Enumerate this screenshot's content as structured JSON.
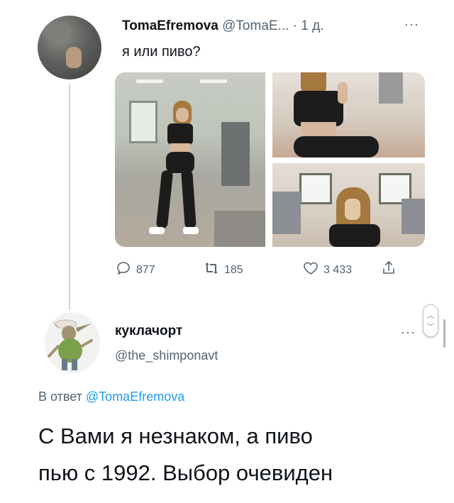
{
  "tweet": {
    "author_name": "TomaEfremova",
    "author_handle": "@TomaE...",
    "time": "· 1 д.",
    "more": "···",
    "text": "я или пиво?",
    "stats": {
      "replies": "877",
      "retweets": "185",
      "likes": "3 433"
    }
  },
  "reply": {
    "author_name": "куклачорт",
    "author_handle": "@the_shimponavt",
    "more": "···",
    "reply_prefix": "В ответ",
    "reply_to": "@TomaEfremova",
    "text_line1": "С Вами я незнаком, а пиво",
    "text_line2": "пью с 1992. Выбор очевиден"
  },
  "icons": {
    "reply": "reply-icon",
    "retweet": "retweet-icon",
    "like": "heart-icon",
    "share": "share-icon"
  },
  "colors": {
    "link": "#1d9bf0",
    "muted": "#536471",
    "text": "#0f1419"
  }
}
